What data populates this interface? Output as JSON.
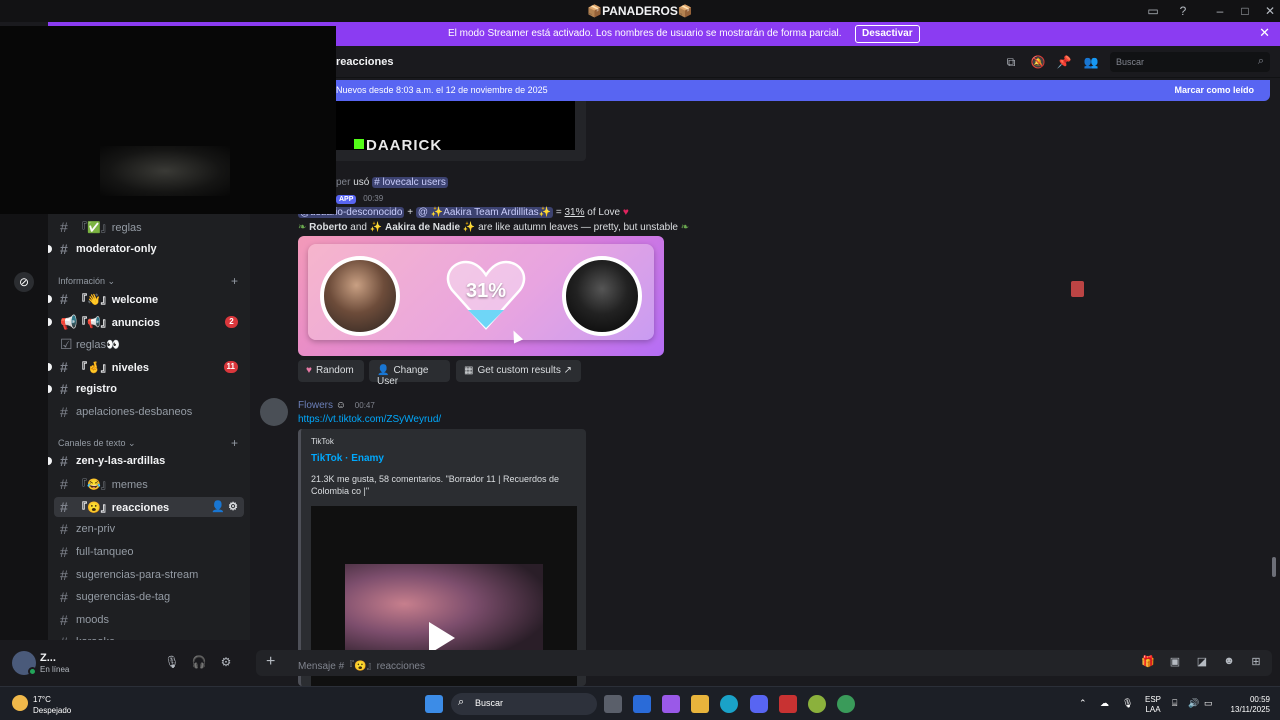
{
  "titlebar": {
    "title": "📦PANADEROS📦"
  },
  "streamer_banner": {
    "message": "El modo Streamer está activado. Los nombres de usuario se mostrarán de forma parcial.",
    "button": "Desactivar"
  },
  "sidebar": {
    "channels_top": [
      {
        "name": "『✅』reglas",
        "unread": false
      },
      {
        "name": "moderator-only",
        "unread": true
      }
    ],
    "cat_info": "Información",
    "info_channels": [
      {
        "name": "『👋』welcome",
        "unread": true,
        "badge": ""
      },
      {
        "name": "『📢』anuncios",
        "unread": true,
        "badge": "2"
      },
      {
        "name": "reglas👀",
        "unread": false,
        "badge": ""
      },
      {
        "name": "『🤞』niveles",
        "unread": true,
        "badge": "11"
      },
      {
        "name": "registro",
        "unread": true,
        "badge": ""
      },
      {
        "name": "apelaciones-desbaneos",
        "unread": false,
        "badge": ""
      }
    ],
    "cat_text": "Canales de texto",
    "text_channels": [
      {
        "name": "zen-y-las-ardillas",
        "unread": true
      },
      {
        "name": "『😂』memes",
        "unread": false
      },
      {
        "name": "『😮』reacciones",
        "unread": false,
        "active": true
      },
      {
        "name": "zen-priv",
        "unread": false
      },
      {
        "name": "full-tanqueo",
        "unread": false
      },
      {
        "name": "sugerencias-para-stream",
        "unread": false
      },
      {
        "name": "sugerencias-de-tag",
        "unread": false
      },
      {
        "name": "moods",
        "unread": false
      },
      {
        "name": "karaoke",
        "unread": false
      }
    ]
  },
  "user": {
    "name": "Z...",
    "status": "En línea"
  },
  "header": {
    "channel": "reacciones",
    "search_placeholder": "Buscar"
  },
  "new_messages": {
    "text": "Nuevos desde 8:03 a.m. el 12 de noviembre de 2025",
    "mark_read": "Marcar como leído"
  },
  "embed_top": {
    "logo_text": "DAARICK"
  },
  "msg1": {
    "used_prefix": "per",
    "used": "usó",
    "command": "lovecalc users",
    "app_tag": "APP",
    "time": "00:39",
    "user1": "@usuario-desconocido",
    "plus": "+",
    "user2": "@ ✨Aakira Team Ardillitas✨",
    "equals": "=",
    "percent": "31%",
    "of_love": "of Love",
    "name1": "Roberto",
    "and": "and",
    "name2": "Aakira de Nadie",
    "tagline": "are like autumn leaves — pretty, but unstable",
    "card_percent": "31%"
  },
  "buttons": {
    "random": "Random",
    "change_user": "Change User",
    "custom": "Get custom results"
  },
  "msg2": {
    "author": "Flowers",
    "time": "00:47",
    "link": "https://vt.tiktok.com/ZSyWeyrud/",
    "provider": "TikTok",
    "title": "TikTok · Enamy",
    "description": "21.3K me gusta, 58 comentarios. \"Borrador 11 | Recuerdos de Colombia co |\""
  },
  "composer": {
    "placeholder": "Mensaje #『😮』reacciones"
  },
  "taskbar": {
    "temp": "17°C",
    "weather": "Despejado",
    "search": "Buscar",
    "lang1": "ESP",
    "lang2": "LAA",
    "time": "00:59",
    "date": "13/11/2025"
  },
  "colors": {
    "accent": "#5865f2",
    "streamer": "#8b3cf2",
    "link": "#00a8fc",
    "badge": "#da373c",
    "online": "#23a55a"
  }
}
